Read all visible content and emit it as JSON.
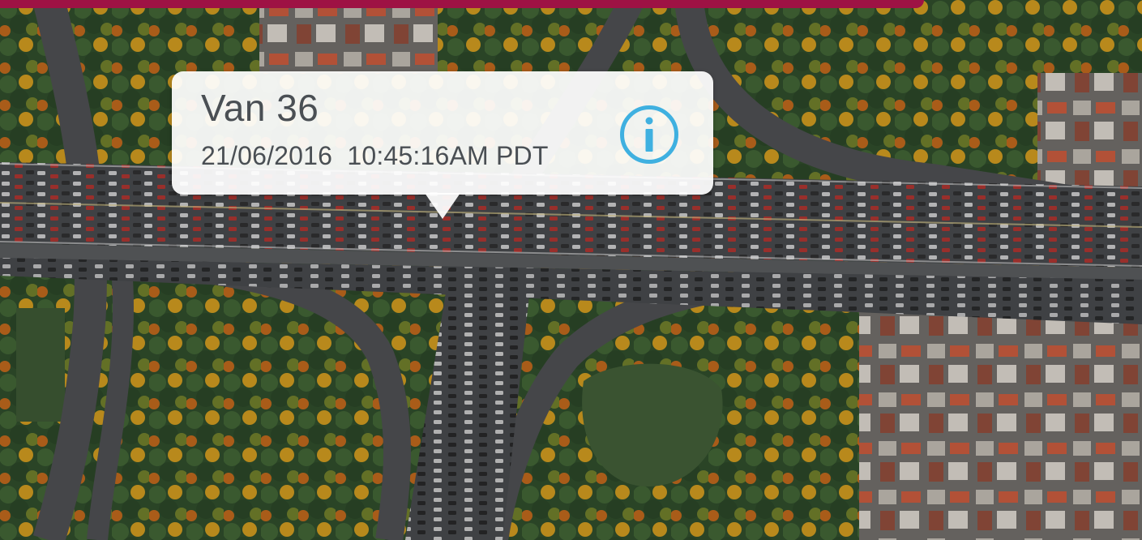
{
  "popup": {
    "vehicle_name": "Van 36",
    "timestamp": "21/06/2016  10:45:16AM PDT"
  },
  "info_button": {
    "icon": "info-icon"
  },
  "colors": {
    "brand_bar": "#9e1244",
    "info_accent": "#3fb0e0",
    "popup_text": "#4a4f54"
  }
}
